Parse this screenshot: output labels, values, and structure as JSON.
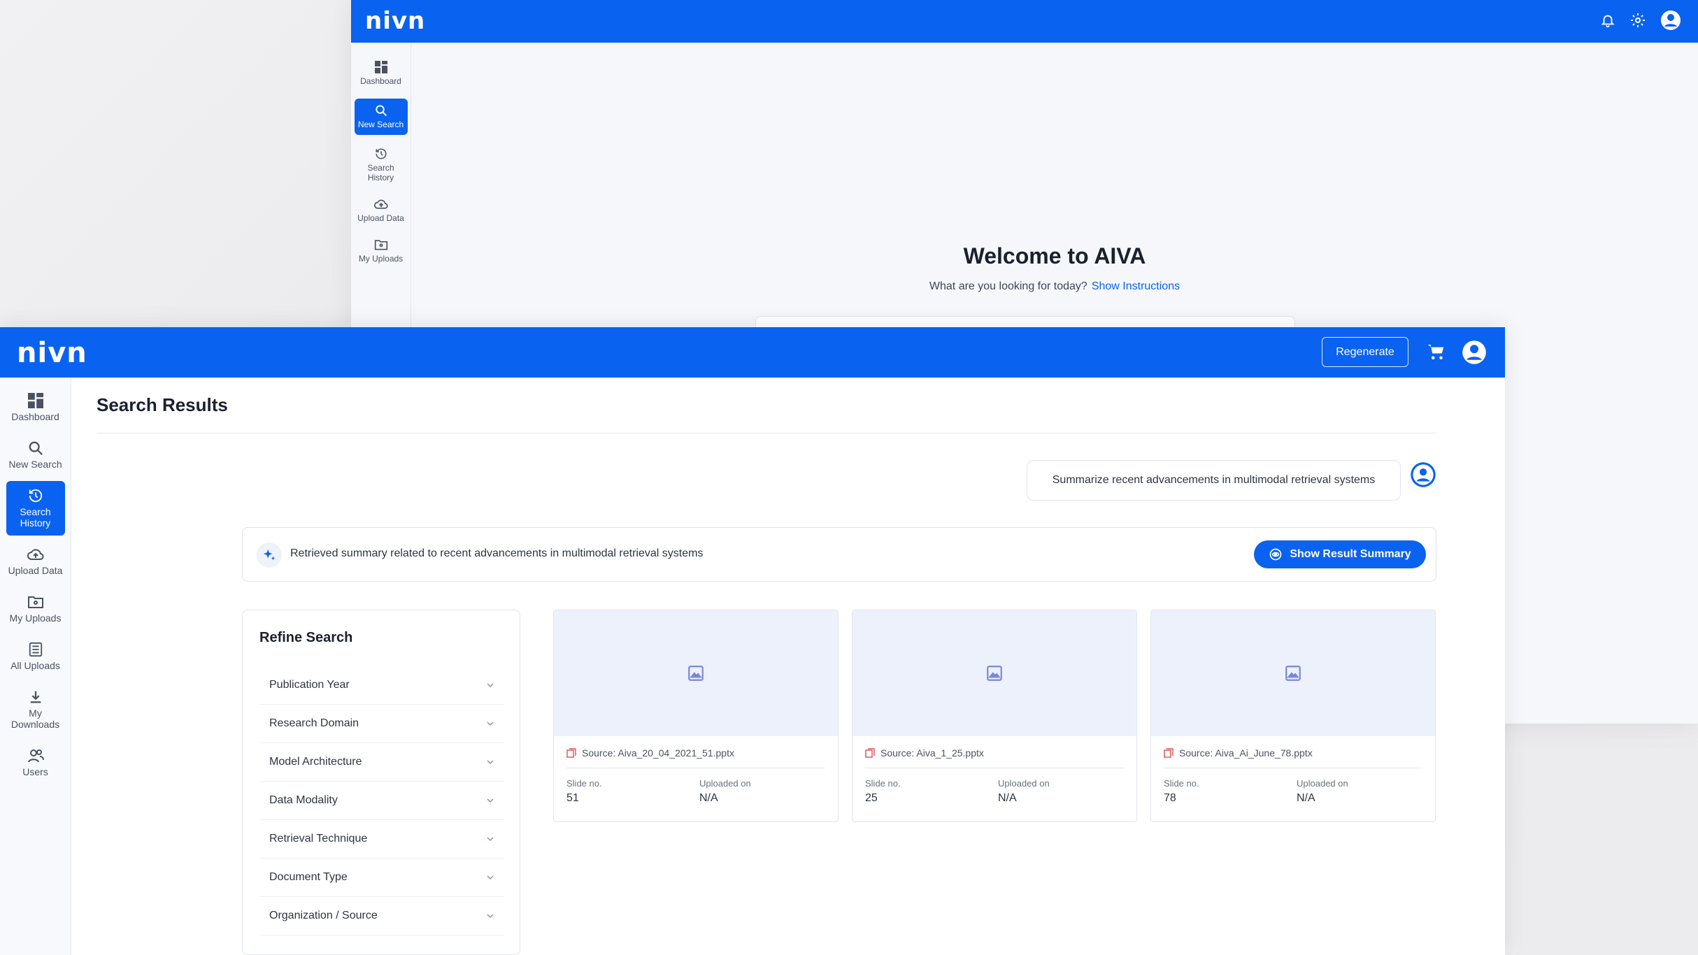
{
  "back_window": {
    "logo": "nivn",
    "sidebar": [
      {
        "label": "Dashboard",
        "icon": "dashboard-icon"
      },
      {
        "label": "New Search",
        "icon": "search-icon",
        "active": true
      },
      {
        "label": "Search History",
        "icon": "history-icon"
      },
      {
        "label": "Upload Data",
        "icon": "upload-cloud-icon"
      },
      {
        "label": "My Uploads",
        "icon": "folder-icon"
      }
    ],
    "welcome_title": "Welcome to AIVA",
    "welcome_subtitle": "What are you looking for today?",
    "show_instructions": "Show Instructions"
  },
  "front_window": {
    "logo": "nivn",
    "regenerate_label": "Regenerate",
    "sidebar": [
      {
        "label": "Dashboard",
        "icon": "dashboard-icon"
      },
      {
        "label": "New Search",
        "icon": "search-icon"
      },
      {
        "label": "Search History",
        "icon": "history-icon",
        "active": true
      },
      {
        "label": "Upload Data",
        "icon": "upload-cloud-icon"
      },
      {
        "label": "My Uploads",
        "icon": "folder-icon"
      },
      {
        "label": "All Uploads",
        "icon": "list-icon"
      },
      {
        "label": "My Downloads",
        "icon": "download-icon"
      },
      {
        "label": "Users",
        "icon": "users-icon"
      }
    ],
    "page_title": "Search Results",
    "query": "Summarize recent advancements in multimodal retrieval systems",
    "summary_text": "Retrieved summary related to recent advancements in multimodal retrieval systems",
    "show_summary_label": "Show Result Summary",
    "refine": {
      "title": "Refine Search",
      "filters": [
        "Publication Year",
        "Research Domain",
        "Model Architecture",
        "Data Modality",
        "Retrieval Technique",
        "Document Type",
        "Organization / Source"
      ]
    },
    "cards": [
      {
        "source": "Source: Aiva_20_04_2021_51.pptx",
        "slide_label": "Slide no.",
        "slide": "51",
        "uploaded_label": "Uploaded on",
        "uploaded": "N/A"
      },
      {
        "source": "Source: Aiva_1_25.pptx",
        "slide_label": "Slide no.",
        "slide": "25",
        "uploaded_label": "Uploaded on",
        "uploaded": "N/A"
      },
      {
        "source": "Source: Aiva_Ai_June_78.pptx",
        "slide_label": "Slide no.",
        "slide": "78",
        "uploaded_label": "Uploaded on",
        "uploaded": "N/A"
      }
    ]
  },
  "colors": {
    "brand": "#0a62f0",
    "file_icon": "#e0585b"
  }
}
